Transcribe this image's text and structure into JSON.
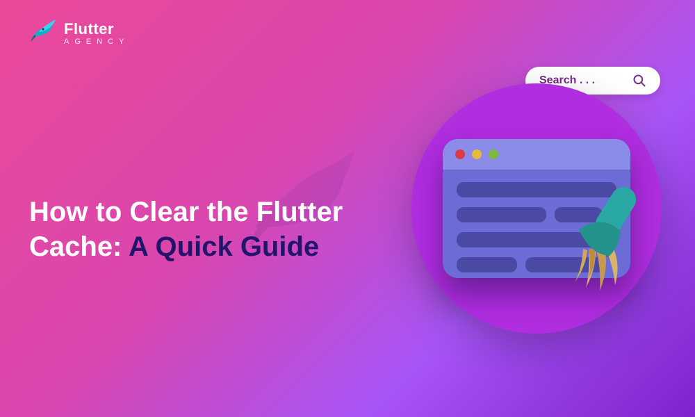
{
  "logo": {
    "top": "Flutter",
    "bottom": "AGENCY"
  },
  "search": {
    "placeholder": "Search . . ."
  },
  "headline": {
    "line1": "How to Clear the Flutter",
    "line2_white": "Cache:",
    "line2_navy": "A Quick Guide"
  },
  "colors": {
    "navy": "#22146b",
    "white": "#ffffff",
    "accent": "#b02de0"
  }
}
